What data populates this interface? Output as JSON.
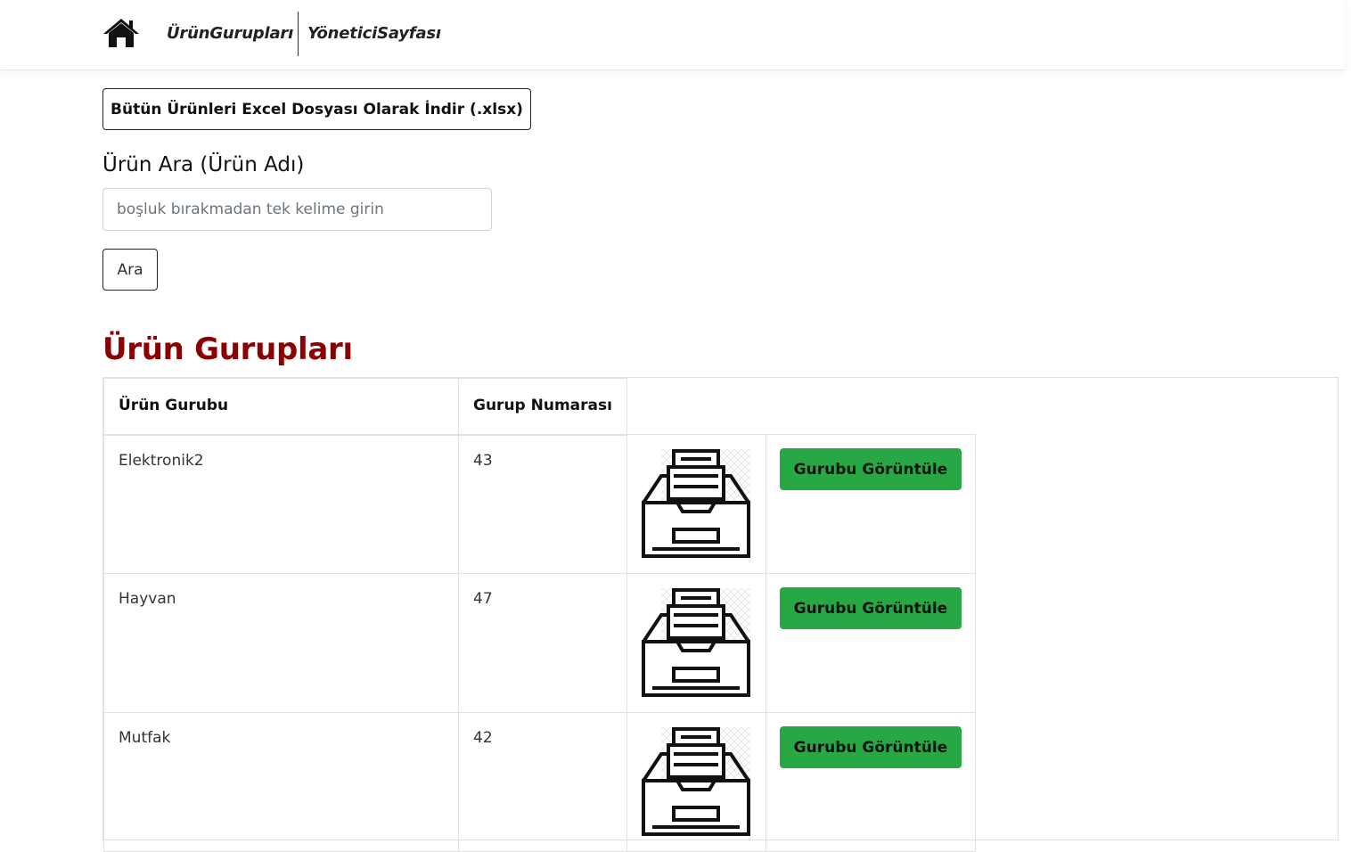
{
  "nav": {
    "home_icon": "home-icon",
    "links": [
      "ÜrünGurupları",
      "YöneticiSayfası"
    ]
  },
  "excel_button": "Bütün Ürünleri Excel Dosyası Olarak İndir (.xlsx)",
  "search": {
    "label": "Ürün Ara (Ürün Adı)",
    "placeholder": "boşluk bırakmadan tek kelime girin",
    "value": "",
    "button": "Ara"
  },
  "section_title": "Ürün Gurupları",
  "table": {
    "headers": [
      "Ürün Gurubu",
      "Gurup Numarası"
    ],
    "rows": [
      {
        "name": "Elektronik2",
        "number": "43",
        "icon": "file-drawer-icon",
        "button": "Gurubu Görüntüle"
      },
      {
        "name": "Hayvan",
        "number": "47",
        "icon": "file-drawer-icon",
        "button": "Gurubu Görüntüle"
      },
      {
        "name": "Mutfak",
        "number": "42",
        "icon": "file-drawer-icon",
        "button": "Gurubu Görüntüle"
      }
    ]
  },
  "colors": {
    "title": "#8b0000",
    "button_green": "#28a745",
    "border": "#dee2e6"
  }
}
